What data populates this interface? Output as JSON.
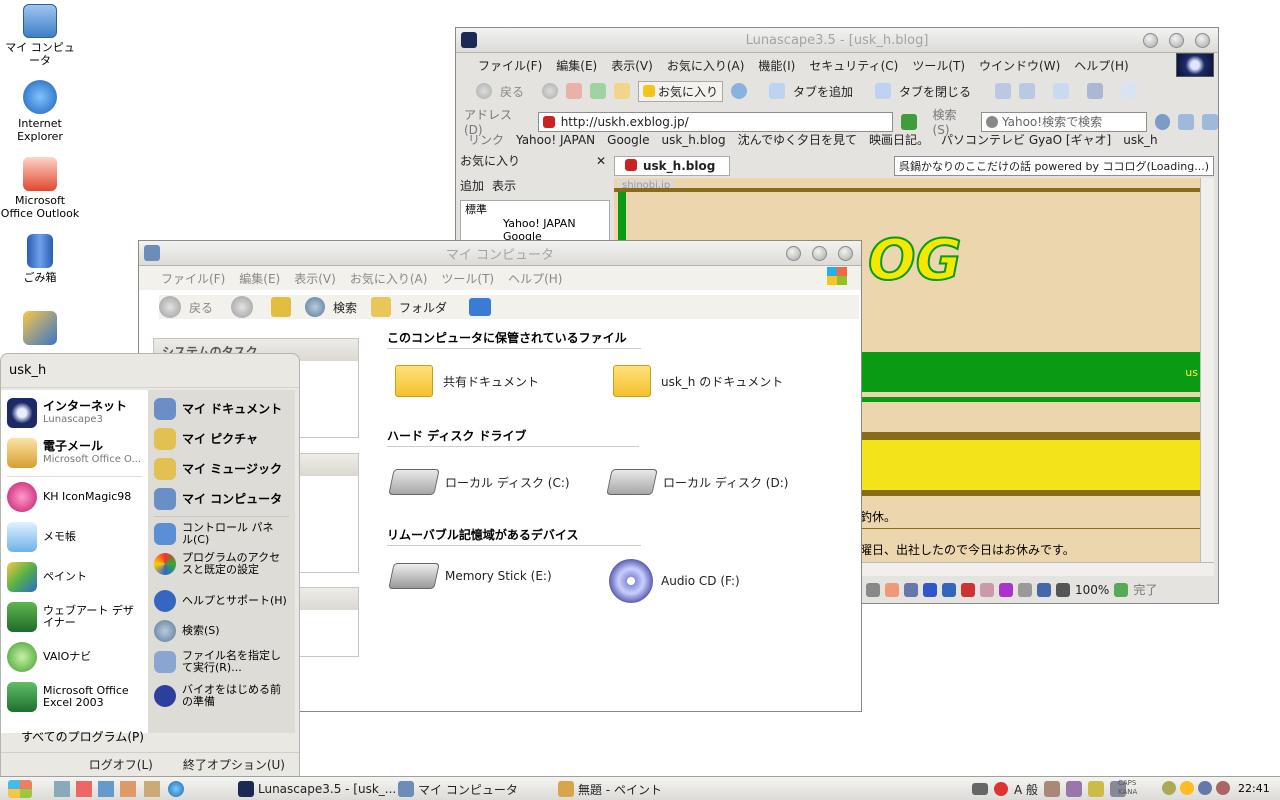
{
  "desktop": {
    "icons": [
      {
        "label": "マイ コンピュータ"
      },
      {
        "label": "Internet Explorer"
      },
      {
        "label": "Microsoft Office Outlook"
      },
      {
        "label": "ごみ箱"
      }
    ]
  },
  "lunascape": {
    "title": "Lunascape3.5 - [usk_h.blog]",
    "menu": [
      "ファイル(F)",
      "編集(E)",
      "表示(V)",
      "お気に入り(A)",
      "機能(I)",
      "セキュリティ(C)",
      "ツール(T)",
      "ウインドウ(W)",
      "ヘルプ(H)"
    ],
    "toolbar": {
      "back": "戻る",
      "favorites": "お気に入り",
      "add_tab": "タブを追加",
      "close_tab": "タブを閉じる"
    },
    "address_label": "アドレス(D)",
    "address_value": "http://uskh.exblog.jp/",
    "search_label": "検索(S)",
    "search_placeholder": "Yahoo!検索で検索",
    "links_label": "リンク",
    "links": [
      "Yahoo! JAPAN",
      "Google",
      "usk_h.blog",
      "沈んでゆく夕日を見て",
      "映画日記。",
      "パソコンテレビ GyaO [ギャオ]",
      "usk_h"
    ],
    "favorites_panel": {
      "title": "お気に入り",
      "add": "追加",
      "view": "表示",
      "items": [
        "標準",
        "Yahoo! JAPAN",
        "Google"
      ]
    },
    "tab_label": "usk_h.blog",
    "ticker": "呉鍋かなりのここだけの話 powered by ココログ(Loading...)",
    "page": {
      "header_tag": "shinobi.jp",
      "logo_text": "OG",
      "line1": "釣休。",
      "line2": "曜日、出社したので今日はお休みです。",
      "green_bar_text": "us"
    },
    "status": {
      "zoom": "100%",
      "done": "完了"
    }
  },
  "mycomputer": {
    "title": "マイ コンピュータ",
    "menu": [
      "ファイル(F)",
      "編集(E)",
      "表示(V)",
      "お気に入り(A)",
      "ツール(T)",
      "ヘルプ(H)"
    ],
    "toolbar": {
      "back": "戻る",
      "search": "検索",
      "folder": "フォルダ"
    },
    "task_header": "システムのタスク",
    "sections": [
      {
        "title": "このコンピュータに保管されているファイル",
        "items": [
          "共有ドキュメント",
          "usk_h のドキュメント"
        ]
      },
      {
        "title": "ハード ディスク ドライブ",
        "items": [
          "ローカル ディスク (C:)",
          "ローカル ディスク (D:)"
        ]
      },
      {
        "title": "リムーバブル記憶域があるデバイス",
        "items": [
          "Memory Stick (E:)",
          "Audio CD (F:)"
        ]
      }
    ]
  },
  "startmenu": {
    "user": "usk_h",
    "pinned": [
      {
        "title": "インターネット",
        "sub": "Lunascape3"
      },
      {
        "title": "電子メール",
        "sub": "Microsoft Office O..."
      }
    ],
    "recent": [
      "KH IconMagic98",
      "メモ帳",
      "ペイント",
      "ウェブアート デザイナー",
      "VAIOナビ",
      "Microsoft Office Excel 2003"
    ],
    "all_programs": "すべてのプログラム(P)",
    "right": [
      "マイ ドキュメント",
      "マイ ピクチャ",
      "マイ ミュージック",
      "マイ コンピュータ",
      "コントロール パネル(C)",
      "プログラムのアクセスと既定の設定",
      "ヘルプとサポート(H)",
      "検索(S)",
      "ファイル名を指定して実行(R)...",
      "バイオをはじめる前の準備"
    ],
    "logoff": "ログオフ(L)",
    "shutdown": "終了オプション(U)"
  },
  "taskbar": {
    "items": [
      "Lunascape3.5 - [usk_...",
      "マイ コンピュータ",
      "無題 - ペイント"
    ],
    "ime": "A 般",
    "caps": "CAPS",
    "kana": "KANA",
    "clock": "22:41"
  }
}
